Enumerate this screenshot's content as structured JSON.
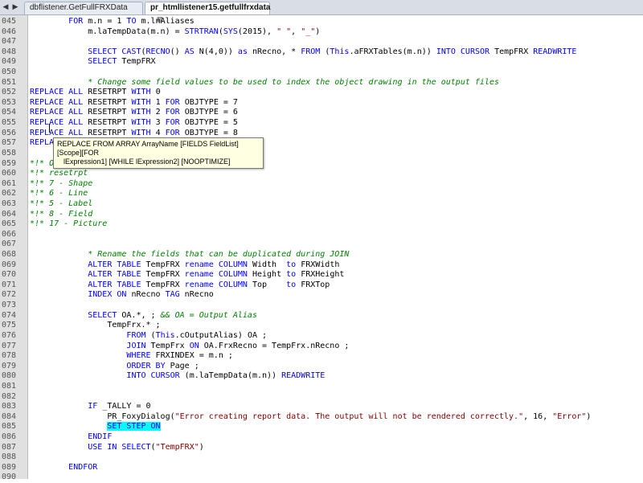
{
  "tabs": [
    {
      "label": "dbflistener.GetFullFRXData",
      "active": false
    },
    {
      "label": "pr_htmllistener15.getfullfrxdata",
      "active": true
    }
  ],
  "tab_close_glyph": "⊠",
  "tooltip": {
    "line1": "REPLACE FROM ARRAY ArrayName [FIELDS FieldList] [Scope][FOR",
    "line2": "lExpression1] [WHILE lExpression2] [NOOPTIMIZE]"
  },
  "lines": [
    {
      "n": "045",
      "t": [
        {
          "s": "        "
        },
        {
          "s": "FOR",
          "c": "kw"
        },
        {
          "s": " m.n = 1 "
        },
        {
          "s": "TO",
          "c": "kw"
        },
        {
          "s": " m.lnAliases"
        }
      ]
    },
    {
      "n": "046",
      "t": [
        {
          "s": "            m.laTempData(m.n) = "
        },
        {
          "s": "STRTRAN",
          "c": "kw"
        },
        {
          "s": "("
        },
        {
          "s": "SYS",
          "c": "kw"
        },
        {
          "s": "(2015), "
        },
        {
          "s": "\" \"",
          "c": "str"
        },
        {
          "s": ", "
        },
        {
          "s": "\"_\"",
          "c": "str"
        },
        {
          "s": ")"
        }
      ]
    },
    {
      "n": "047",
      "t": []
    },
    {
      "n": "048",
      "t": [
        {
          "s": "            "
        },
        {
          "s": "SELECT CAST",
          "c": "kw"
        },
        {
          "s": "("
        },
        {
          "s": "RECNO",
          "c": "kw"
        },
        {
          "s": "() "
        },
        {
          "s": "AS",
          "c": "kw"
        },
        {
          "s": " N(4,0)) "
        },
        {
          "s": "as",
          "c": "kw"
        },
        {
          "s": " nRecno, * "
        },
        {
          "s": "FROM",
          "c": "kw"
        },
        {
          "s": " ("
        },
        {
          "s": "This",
          "c": "kw"
        },
        {
          "s": ".aFRXTables(m.n)) "
        },
        {
          "s": "INTO CURSOR",
          "c": "kw"
        },
        {
          "s": " TempFRX "
        },
        {
          "s": "READWRITE",
          "c": "kw"
        }
      ]
    },
    {
      "n": "049",
      "t": [
        {
          "s": "            "
        },
        {
          "s": "SELECT",
          "c": "kw"
        },
        {
          "s": " TempFRX"
        }
      ]
    },
    {
      "n": "050",
      "t": []
    },
    {
      "n": "051",
      "t": [
        {
          "s": "            "
        },
        {
          "s": "* Change some field values to be used to index the object drawing in the output files",
          "c": "cmt"
        }
      ]
    },
    {
      "n": "052",
      "t": [
        {
          "s": "REPLACE ALL",
          "c": "kw"
        },
        {
          "s": " RESETRPT "
        },
        {
          "s": "WITH",
          "c": "kw"
        },
        {
          "s": " 0"
        }
      ]
    },
    {
      "n": "053",
      "t": [
        {
          "s": "REPLACE ALL",
          "c": "kw"
        },
        {
          "s": " RESETRPT "
        },
        {
          "s": "WITH",
          "c": "kw"
        },
        {
          "s": " 1 "
        },
        {
          "s": "FOR",
          "c": "kw"
        },
        {
          "s": " OBJTYPE = 7"
        }
      ]
    },
    {
      "n": "054",
      "t": [
        {
          "s": "REPLACE ALL",
          "c": "kw"
        },
        {
          "s": " RESETRPT "
        },
        {
          "s": "WITH",
          "c": "kw"
        },
        {
          "s": " 2 "
        },
        {
          "s": "FOR",
          "c": "kw"
        },
        {
          "s": " OBJTYPE = 6"
        }
      ]
    },
    {
      "n": "055",
      "t": [
        {
          "s": "REPLACE ALL",
          "c": "kw"
        },
        {
          "s": " RESETRPT "
        },
        {
          "s": "WITH",
          "c": "kw"
        },
        {
          "s": " 3 "
        },
        {
          "s": "FOR",
          "c": "kw"
        },
        {
          "s": " OBJTYPE = 5"
        }
      ]
    },
    {
      "n": "056",
      "t": [
        {
          "s": "REPLACE ALL",
          "c": "kw"
        },
        {
          "s": " RESETRPT "
        },
        {
          "s": "WITH",
          "c": "kw"
        },
        {
          "s": " 4 "
        },
        {
          "s": "FOR",
          "c": "kw"
        },
        {
          "s": " OBJTYPE = 8"
        }
      ]
    },
    {
      "n": "057",
      "t": [
        {
          "s": "REPLA",
          "c": "kw"
        }
      ]
    },
    {
      "n": "058",
      "t": []
    },
    {
      "n": "059",
      "t": [
        {
          "s": "*!* OBJTYPE",
          "c": "cmt"
        }
      ]
    },
    {
      "n": "060",
      "t": [
        {
          "s": "*!* resetrpt",
          "c": "cmt"
        }
      ]
    },
    {
      "n": "061",
      "t": [
        {
          "s": "*!* 7 - Shape",
          "c": "cmt"
        }
      ]
    },
    {
      "n": "062",
      "t": [
        {
          "s": "*!* 6 - Line",
          "c": "cmt"
        }
      ]
    },
    {
      "n": "063",
      "t": [
        {
          "s": "*!* 5 - Label",
          "c": "cmt"
        }
      ]
    },
    {
      "n": "064",
      "t": [
        {
          "s": "*!* 8 - Field",
          "c": "cmt"
        }
      ]
    },
    {
      "n": "065",
      "t": [
        {
          "s": "*!* 17 - Picture",
          "c": "cmt"
        }
      ]
    },
    {
      "n": "066",
      "t": []
    },
    {
      "n": "067",
      "t": []
    },
    {
      "n": "068",
      "t": [
        {
          "s": "            "
        },
        {
          "s": "* Rename the fields that can be duplicated during JOIN",
          "c": "cmt"
        }
      ]
    },
    {
      "n": "069",
      "t": [
        {
          "s": "            "
        },
        {
          "s": "ALTER TABLE",
          "c": "kw"
        },
        {
          "s": " TempFRX "
        },
        {
          "s": "rename COLUMN",
          "c": "kw"
        },
        {
          "s": " Width  "
        },
        {
          "s": "to",
          "c": "kw"
        },
        {
          "s": " FRXWidth"
        }
      ]
    },
    {
      "n": "070",
      "t": [
        {
          "s": "            "
        },
        {
          "s": "ALTER TABLE",
          "c": "kw"
        },
        {
          "s": " TempFRX "
        },
        {
          "s": "rename COLUMN",
          "c": "kw"
        },
        {
          "s": " Height "
        },
        {
          "s": "to",
          "c": "kw"
        },
        {
          "s": " FRXHeight"
        }
      ]
    },
    {
      "n": "071",
      "t": [
        {
          "s": "            "
        },
        {
          "s": "ALTER TABLE",
          "c": "kw"
        },
        {
          "s": " TempFRX "
        },
        {
          "s": "rename COLUMN",
          "c": "kw"
        },
        {
          "s": " Top    "
        },
        {
          "s": "to",
          "c": "kw"
        },
        {
          "s": " FRXTop"
        }
      ]
    },
    {
      "n": "072",
      "t": [
        {
          "s": "            "
        },
        {
          "s": "INDEX ON",
          "c": "kw"
        },
        {
          "s": " nRecno "
        },
        {
          "s": "TAG",
          "c": "kw"
        },
        {
          "s": " nRecno"
        }
      ]
    },
    {
      "n": "073",
      "t": []
    },
    {
      "n": "074",
      "t": [
        {
          "s": "            "
        },
        {
          "s": "SELECT",
          "c": "kw"
        },
        {
          "s": " OA.*, ; "
        },
        {
          "s": "&& OA = Output Alias",
          "c": "cmt"
        }
      ]
    },
    {
      "n": "075",
      "t": [
        {
          "s": "                TempFrx.* ;"
        }
      ]
    },
    {
      "n": "076",
      "t": [
        {
          "s": "                    "
        },
        {
          "s": "FROM",
          "c": "kw"
        },
        {
          "s": " ("
        },
        {
          "s": "This",
          "c": "kw"
        },
        {
          "s": ".cOutputAlias) OA ;"
        }
      ]
    },
    {
      "n": "077",
      "t": [
        {
          "s": "                    "
        },
        {
          "s": "JOIN",
          "c": "kw"
        },
        {
          "s": " TempFrx "
        },
        {
          "s": "ON",
          "c": "kw"
        },
        {
          "s": " OA.FrxRecno = TempFrx.nRecno ;"
        }
      ]
    },
    {
      "n": "078",
      "t": [
        {
          "s": "                    "
        },
        {
          "s": "WHERE",
          "c": "kw"
        },
        {
          "s": " FRXINDEX = m.n ;"
        }
      ]
    },
    {
      "n": "079",
      "t": [
        {
          "s": "                    "
        },
        {
          "s": "ORDER BY",
          "c": "kw"
        },
        {
          "s": " Page ;"
        }
      ]
    },
    {
      "n": "080",
      "t": [
        {
          "s": "                    "
        },
        {
          "s": "INTO CURSOR",
          "c": "kw"
        },
        {
          "s": " (m.laTempData(m.n)) "
        },
        {
          "s": "READWRITE",
          "c": "kw"
        }
      ]
    },
    {
      "n": "081",
      "t": []
    },
    {
      "n": "082",
      "t": []
    },
    {
      "n": "083",
      "t": [
        {
          "s": "            "
        },
        {
          "s": "IF",
          "c": "kw"
        },
        {
          "s": " _TALLY = 0"
        }
      ]
    },
    {
      "n": "084",
      "t": [
        {
          "s": "                PR_FoxyDialog("
        },
        {
          "s": "\"Error creating report data. The output will not be rendered correctly.\"",
          "c": "str"
        },
        {
          "s": ", 16, "
        },
        {
          "s": "\"Error\"",
          "c": "str"
        },
        {
          "s": ")"
        }
      ]
    },
    {
      "n": "085",
      "t": [
        {
          "s": "                "
        },
        {
          "s": "SET STEP ON",
          "c": "kw hl"
        }
      ]
    },
    {
      "n": "086",
      "t": [
        {
          "s": "            "
        },
        {
          "s": "ENDIF",
          "c": "kw"
        }
      ]
    },
    {
      "n": "087",
      "t": [
        {
          "s": "            "
        },
        {
          "s": "USE IN SELECT",
          "c": "kw"
        },
        {
          "s": "("
        },
        {
          "s": "\"TempFRX\"",
          "c": "str"
        },
        {
          "s": ")"
        }
      ]
    },
    {
      "n": "088",
      "t": []
    },
    {
      "n": "089",
      "t": [
        {
          "s": "        "
        },
        {
          "s": "ENDFOR",
          "c": "kw"
        }
      ]
    },
    {
      "n": "090",
      "t": []
    }
  ]
}
